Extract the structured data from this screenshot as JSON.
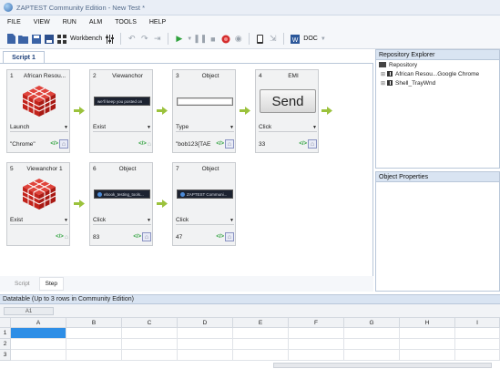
{
  "window": {
    "title": "ZAPTEST Community Edition  -  New Test *"
  },
  "menu": [
    "FILE",
    "VIEW",
    "RUN",
    "ALM",
    "TOOLS",
    "HELP"
  ],
  "toolbar": {
    "workbench_label": "Workbench",
    "doc_label": "DOC"
  },
  "script_tab": "Script 1",
  "steps": [
    {
      "num": "1",
      "title": "African Resou...",
      "action": "Launch",
      "value": "\"Chrome\"",
      "image": "cube-icon"
    },
    {
      "num": "2",
      "title": "Viewanchor",
      "action": "Exist",
      "value": "",
      "image": "dark-screenshot",
      "shot_text": "we'll keep you posted on"
    },
    {
      "num": "3",
      "title": "Object",
      "action": "Type",
      "value": "\"bob123{TAE",
      "image": "input-screenshot"
    },
    {
      "num": "4",
      "title": "EMI",
      "action": "Click",
      "value": "33",
      "image": "send-button",
      "button_text": "Send"
    },
    {
      "num": "5",
      "title": "Viewanchor 1",
      "action": "Exist",
      "value": "",
      "image": "cube-icon"
    },
    {
      "num": "6",
      "title": "Object",
      "action": "Click",
      "value": "83",
      "image": "dark-screenshot",
      "shot_text": "ebook_testing_tools..."
    },
    {
      "num": "7",
      "title": "Object",
      "action": "Click",
      "value": "47",
      "image": "dark-screenshot",
      "shot_text": "ZAPTEST Communi..."
    }
  ],
  "bottom_tabs": [
    "Script",
    "Step"
  ],
  "repository": {
    "title": "Repository Explorer",
    "root": "Repository",
    "items": [
      "African Resou...Google Chrome",
      "Shell_TrayWnd"
    ]
  },
  "properties": {
    "title": "Object Properties"
  },
  "datatable": {
    "title": "Datatable (Up to 3 rows in Community Edition)",
    "cell_ref": "A1",
    "columns": [
      "A",
      "B",
      "C",
      "D",
      "E",
      "F",
      "G",
      "H",
      "I"
    ],
    "rows": [
      "1",
      "2",
      "3"
    ]
  }
}
